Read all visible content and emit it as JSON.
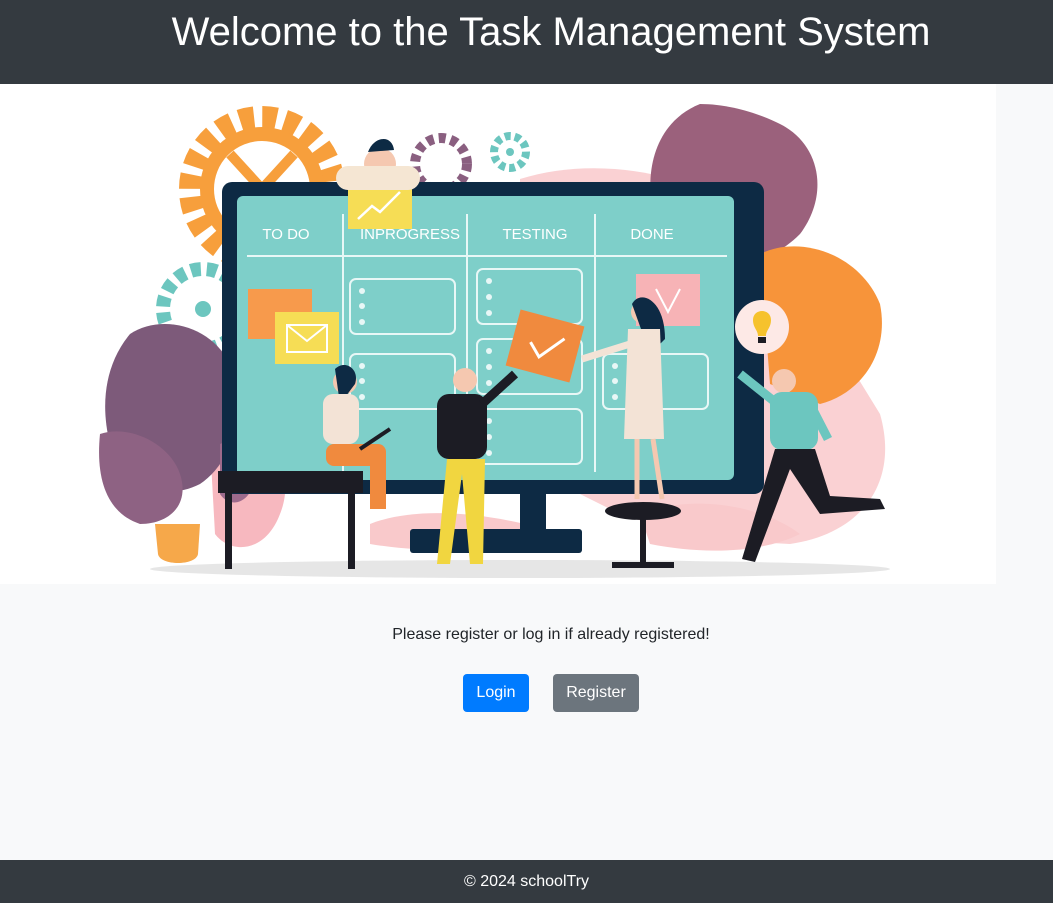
{
  "header": {
    "title": "Welcome to the Task Management System"
  },
  "hero": {
    "board_columns": [
      "TO DO",
      "INPROGRESS",
      "TESTING",
      "DONE"
    ]
  },
  "main": {
    "prompt": "Please register or log in if already registered!",
    "login_label": "Login",
    "register_label": "Register"
  },
  "footer": {
    "text": "© 2024 schoolTry"
  },
  "colors": {
    "header_bg": "#343a40",
    "primary": "#007bff",
    "secondary": "#6c757d",
    "page_bg": "#f8f9fa"
  }
}
